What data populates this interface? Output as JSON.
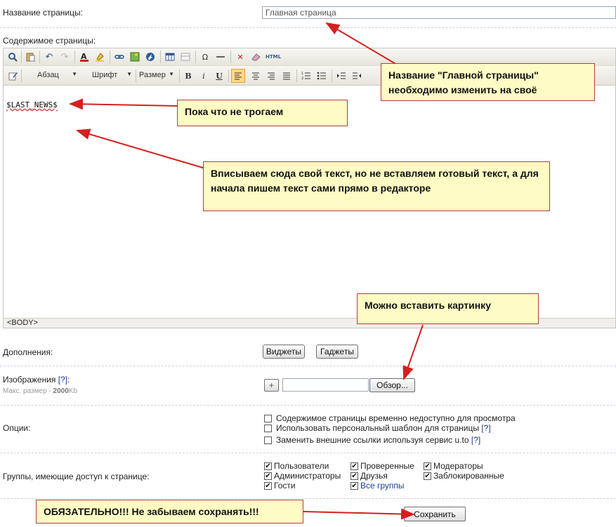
{
  "page_name": {
    "label": "Название страницы:",
    "value": "Главная страница"
  },
  "content": {
    "label": "Содержимое страницы:",
    "editor_text": "$LAST_NEWS$",
    "status_path": "<BODY>",
    "toolbar": {
      "format_select": "Абзац",
      "font_select": "Шрифт",
      "size_select": "Размер",
      "bold": "B",
      "italic": "i",
      "underline": "U",
      "omega": "Ω",
      "html": "HTML"
    }
  },
  "addons": {
    "label": "Дополнения:",
    "widgets_button": "Виджеты",
    "gadgets_button": "Гаджеты"
  },
  "images": {
    "label": "Изображения",
    "help": "[?]",
    "colon": ":",
    "max_size_prefix": "Макс. размер - ",
    "max_size_value": "2000",
    "max_size_unit": "Kb",
    "add_button": "+",
    "browse_button": "Обзор..."
  },
  "options": {
    "label": "Опции:",
    "items": [
      {
        "label": "Содержимое страницы временно недоступно для просмотра",
        "help": "",
        "checked": false
      },
      {
        "label": "Использовать персональный шаблон для страницы",
        "help": "[?]",
        "checked": false
      },
      {
        "label": "Заменить внешние ссылки используя сервис u.to",
        "help": "[?]",
        "checked": false
      }
    ]
  },
  "groups": {
    "label": "Группы, имеющие доступ к странице:",
    "items": [
      {
        "label": "Пользователи",
        "checked": true
      },
      {
        "label": "Проверенные",
        "checked": true
      },
      {
        "label": "Модераторы",
        "checked": true
      },
      {
        "label": "Администраторы",
        "checked": true
      },
      {
        "label": "Друзья",
        "checked": true
      },
      {
        "label": "Заблокированные",
        "checked": true
      },
      {
        "label": "Гости",
        "checked": true
      },
      {
        "label": "Все группы",
        "checked": true
      }
    ]
  },
  "save_button": "Сохранить",
  "annotations": {
    "rename": "Название \"Главной страницы\" необходимо изменить на своё",
    "dont_touch": "Пока что не трогаем",
    "write_text": "Вписываем сюда свой текст, но не вставляем готовый текст, а для начала пишем текст сами прямо в редакторе",
    "insert_image": "Можно вставить картинку",
    "must_save": "ОБЯЗАТЕЛЬНО!!! Не забываем сохранять!!!"
  },
  "colors": {
    "annotation_bg": "#fefbc4",
    "arrow": "#d42020",
    "link": "#1a3f8f"
  }
}
